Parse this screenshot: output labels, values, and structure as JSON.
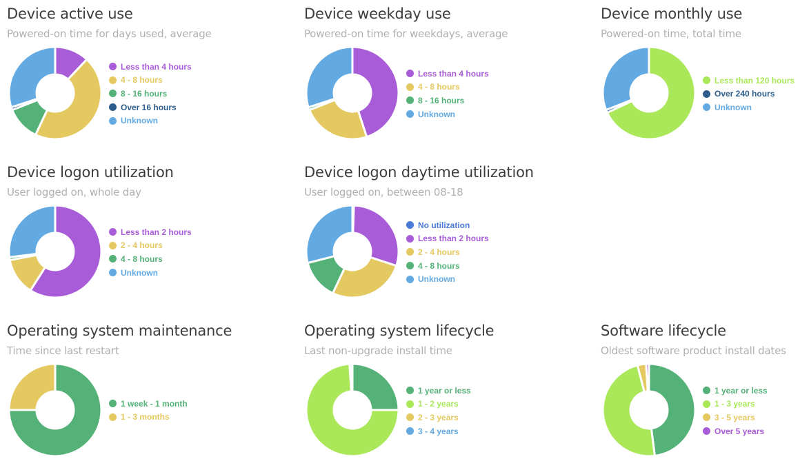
{
  "palette": {
    "purple": "#a95cd8",
    "yellow": "#e4c860",
    "green": "#54b177",
    "darkblue": "#2c5d8c",
    "lightblue": "#63aae2",
    "lime": "#aae85a",
    "royalblue": "#4a7ad8"
  },
  "chart_data": [
    {
      "type": "pie",
      "title": "Device active use",
      "subtitle": "Powered-on time for days used, average",
      "slices": [
        {
          "label": "Less than 4 hours",
          "value": 12,
          "color": "#a95cd8"
        },
        {
          "label": "4 - 8 hours",
          "value": 45,
          "color": "#e4c860"
        },
        {
          "label": "8 - 16 hours",
          "value": 12,
          "color": "#54b177"
        },
        {
          "label": "Over 16 hours",
          "value": 1,
          "color": "#2c5d8c"
        },
        {
          "label": "Unknown",
          "value": 30,
          "color": "#63aae2"
        }
      ]
    },
    {
      "type": "pie",
      "title": "Device weekday use",
      "subtitle": "Powered-on time for weekdays, average",
      "slices": [
        {
          "label": "Less than 4 hours",
          "value": 45,
          "color": "#a95cd8"
        },
        {
          "label": "4 - 8 hours",
          "value": 24,
          "color": "#e4c860"
        },
        {
          "label": "8 - 16 hours",
          "value": 1,
          "color": "#54b177"
        },
        {
          "label": "Unknown",
          "value": 30,
          "color": "#63aae2"
        }
      ]
    },
    {
      "type": "pie",
      "title": "Device monthly use",
      "subtitle": "Powered-on time, total time",
      "slices": [
        {
          "label": "Less than 120 hours",
          "value": 68,
          "color": "#aae85a"
        },
        {
          "label": "Over 240 hours",
          "value": 1,
          "color": "#2c5d8c"
        },
        {
          "label": "Unknown",
          "value": 31,
          "color": "#63aae2"
        }
      ]
    },
    {
      "type": "pie",
      "title": "Device logon utilization",
      "subtitle": "User logged on, whole day",
      "slices": [
        {
          "label": "Less than 2 hours",
          "value": 59,
          "color": "#a95cd8"
        },
        {
          "label": "2 - 4 hours",
          "value": 13,
          "color": "#e4c860"
        },
        {
          "label": "4 - 8 hours",
          "value": 1,
          "color": "#54b177"
        },
        {
          "label": "Unknown",
          "value": 27,
          "color": "#63aae2"
        }
      ]
    },
    {
      "type": "pie",
      "title": "Device logon daytime utilization",
      "subtitle": "User logged on, between 08-18",
      "slices": [
        {
          "label": "No utilization",
          "value": 0.5,
          "color": "#4a7ad8"
        },
        {
          "label": "Less than 2 hours",
          "value": 29.5,
          "color": "#a95cd8"
        },
        {
          "label": "2 - 4 hours",
          "value": 27,
          "color": "#e4c860"
        },
        {
          "label": "4 - 8 hours",
          "value": 14,
          "color": "#54b177"
        },
        {
          "label": "Unknown",
          "value": 29,
          "color": "#63aae2"
        }
      ]
    },
    {
      "type": "pie",
      "title": "Operating system maintenance",
      "subtitle": "Time since last restart",
      "slices": [
        {
          "label": "1 week - 1 month",
          "value": 75,
          "color": "#54b177"
        },
        {
          "label": "1 - 3 months",
          "value": 25,
          "color": "#e4c860"
        }
      ]
    },
    {
      "type": "pie",
      "title": "Operating system lifecycle",
      "subtitle": "Last non-upgrade install time",
      "slices": [
        {
          "label": "1 year or less",
          "value": 25,
          "color": "#54b177"
        },
        {
          "label": "1 - 2 years",
          "value": 74,
          "color": "#aae85a"
        },
        {
          "label": "2 - 3 years",
          "value": 0.2,
          "color": "#e4c860"
        },
        {
          "label": "3 - 4 years",
          "value": 0.8,
          "color": "#63aae2"
        }
      ]
    },
    {
      "type": "pie",
      "title": "Software lifecycle",
      "subtitle": "Oldest software product install dates",
      "slices": [
        {
          "label": "1 year or less",
          "value": 48,
          "color": "#54b177"
        },
        {
          "label": "1 - 3 years",
          "value": 48,
          "color": "#aae85a"
        },
        {
          "label": "3 - 5 years",
          "value": 3,
          "color": "#e4c860"
        },
        {
          "label": "Over 5 years",
          "value": 1,
          "color": "#a95cd8"
        }
      ]
    }
  ]
}
